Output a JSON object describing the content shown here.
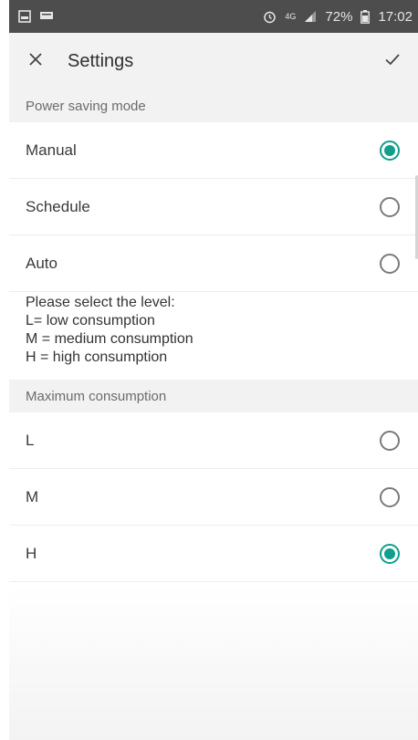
{
  "status_bar": {
    "battery_percent": "72%",
    "time": "17:02",
    "network": "4G",
    "icons": [
      "image-icon",
      "message-icon",
      "alarm-icon",
      "network-4g-icon",
      "signal-icon",
      "battery-icon"
    ]
  },
  "app_bar": {
    "title": "Settings",
    "close_icon": "close-icon",
    "confirm_icon": "check-icon"
  },
  "power_saving": {
    "header": "Power saving mode",
    "options": [
      {
        "label": "Manual",
        "selected": true
      },
      {
        "label": "Schedule",
        "selected": false
      },
      {
        "label": "Auto",
        "selected": false
      }
    ]
  },
  "info_lines": [
    "Please select the level:",
    "L= low consumption",
    "M = medium consumption",
    "H = high consumption"
  ],
  "max_consumption": {
    "header": "Maximum consumption",
    "options": [
      {
        "label": "L",
        "selected": false
      },
      {
        "label": "M",
        "selected": false
      },
      {
        "label": "H",
        "selected": true
      }
    ]
  },
  "colors": {
    "accent": "#119e8c",
    "status_bar": "#4d4d4d",
    "header_bg": "#f2f2f2"
  }
}
